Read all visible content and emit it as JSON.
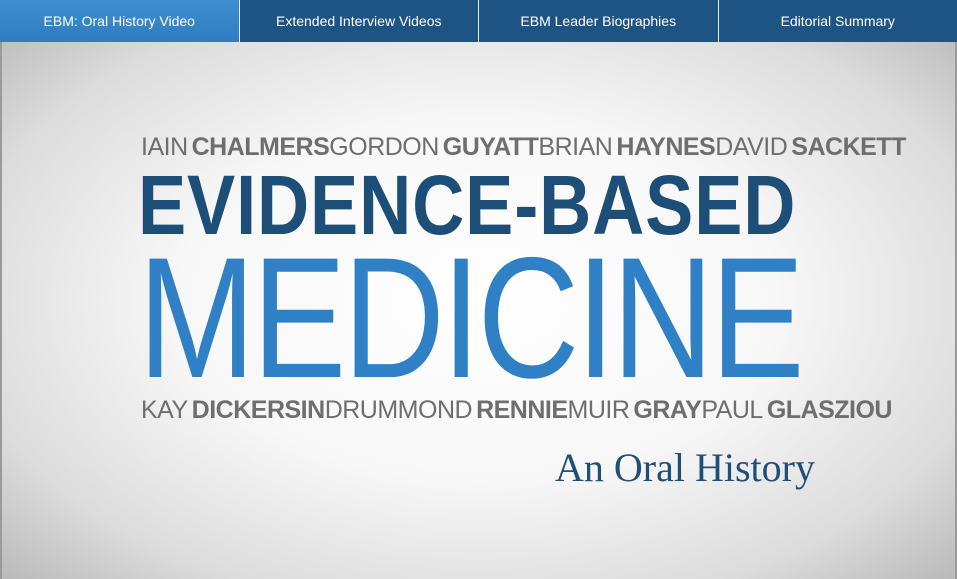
{
  "tabs": [
    {
      "label": "EBM: Oral History Video",
      "active": true
    },
    {
      "label": "Extended Interview Videos",
      "active": false
    },
    {
      "label": "EBM Leader Biographies",
      "active": false
    },
    {
      "label": "Editorial Summary",
      "active": false
    }
  ],
  "hero": {
    "top_names": [
      {
        "first": "IAIN",
        "last": "CHALMERS"
      },
      {
        "first": "GORDON",
        "last": "GUYATT"
      },
      {
        "first": "BRIAN",
        "last": "HAYNES"
      },
      {
        "first": "DAVID",
        "last": "SACKETT"
      }
    ],
    "title_line1": "EVIDENCE-BASED",
    "title_line2": "MEDICINE",
    "bottom_names": [
      {
        "first": "KAY",
        "last": "DICKERSIN"
      },
      {
        "first": "DRUMMOND",
        "last": "RENNIE"
      },
      {
        "first": "MUIR",
        "last": "GRAY"
      },
      {
        "first": "PAUL",
        "last": "GLASZIOU"
      }
    ],
    "subtitle": "An Oral History"
  },
  "colors": {
    "tab_bg": "#1d5483",
    "tab_active_bg": "#3485c8",
    "title_dark_blue": "#1c4e78",
    "title_light_blue": "#2f80c4",
    "names_gray": "#6e6e6e"
  }
}
